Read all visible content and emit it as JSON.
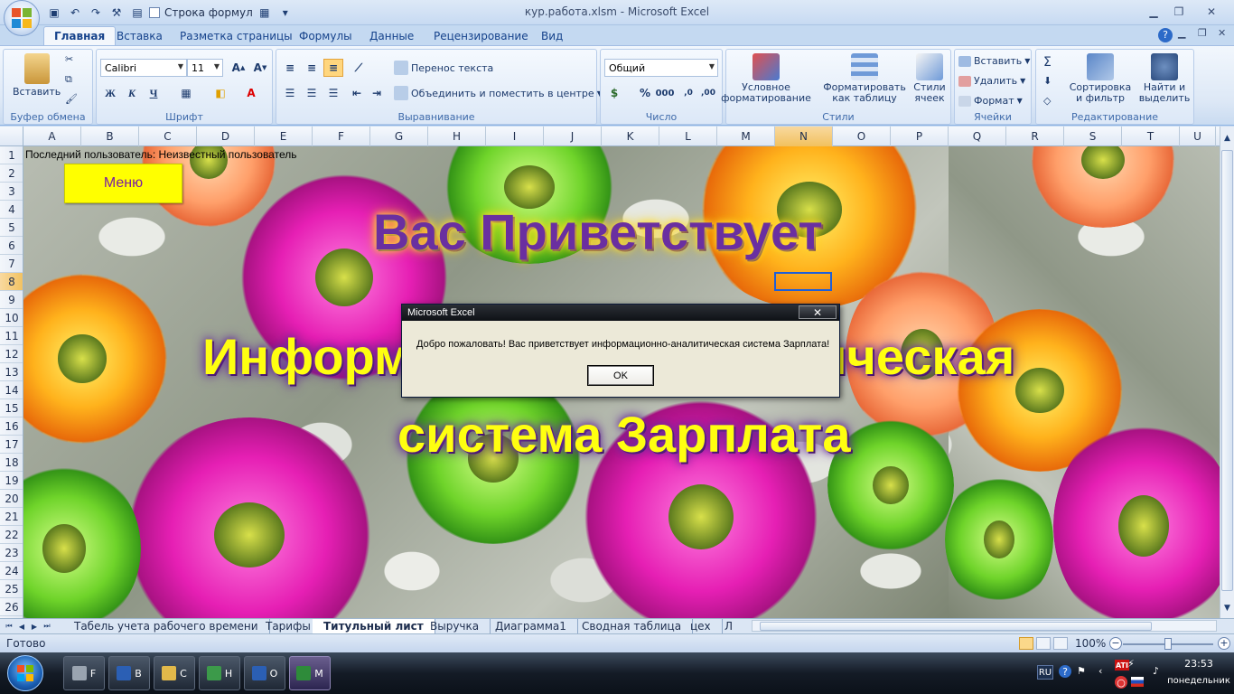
{
  "window": {
    "title": "кур.работа.xlsm - Microsoft Excel",
    "qat_formula_label": "Строка формул"
  },
  "tabs": [
    "Главная",
    "Вставка",
    "Разметка страницы",
    "Формулы",
    "Данные",
    "Рецензирование",
    "Вид"
  ],
  "ribbon": {
    "clipboard": {
      "label": "Буфер обмена",
      "paste": "Вставить"
    },
    "font": {
      "label": "Шрифт",
      "name": "Calibri",
      "size": "11",
      "bold": "Ж",
      "italic": "К",
      "underline": "Ч"
    },
    "alignment": {
      "label": "Выравнивание",
      "wrap": "Перенос текста",
      "merge": "Объединить и поместить в центре"
    },
    "number": {
      "label": "Число",
      "format": "Общий",
      "percent": "%",
      "thousands": "000"
    },
    "styles": {
      "label": "Стили",
      "conditional": "Условное форматирование",
      "as_table": "Форматировать как таблицу",
      "cell_styles": "Стили ячеек"
    },
    "cells": {
      "label": "Ячейки",
      "insert": "Вставить",
      "delete": "Удалить",
      "format": "Формат"
    },
    "editing": {
      "label": "Редактирование",
      "sort": "Сортировка и фильтр",
      "find": "Найти и выделить"
    }
  },
  "columns": [
    "A",
    "B",
    "C",
    "D",
    "E",
    "F",
    "G",
    "H",
    "I",
    "J",
    "K",
    "L",
    "M",
    "N",
    "O",
    "P",
    "Q",
    "R",
    "S",
    "T",
    "U"
  ],
  "selected_column": "N",
  "rows": [
    "1",
    "2",
    "3",
    "4",
    "5",
    "6",
    "7",
    "8",
    "9",
    "10",
    "11",
    "12",
    "13",
    "14",
    "15",
    "16",
    "17",
    "18",
    "19",
    "20",
    "21",
    "22",
    "23",
    "24",
    "25",
    "26"
  ],
  "selected_row": "8",
  "sheet": {
    "last_user": "Последний пользователь: Неизвестный пользователь",
    "menu_button": "Меню",
    "wordart_line1": "Вас Приветствует",
    "wordart_line2": "Информационно-аналитическая",
    "wordart_line3": "система Зарплата"
  },
  "dialog": {
    "title": "Microsoft Excel",
    "message": "Добро пожаловать! Вас приветствует  информационно-аналитическая система Зарплата!",
    "ok": "OK"
  },
  "sheet_tabs": [
    "Табель учета рабочего времени",
    "Тарифы",
    "Титульный лист",
    "Выручка",
    "Диаграмма1",
    "Сводная таблица",
    "цех",
    "Л"
  ],
  "active_sheet": "Титульный лист",
  "status": {
    "ready": "Готово",
    "zoom": "100%"
  },
  "taskbar": {
    "buttons": [
      {
        "letter": "F",
        "icon": "folder-drive-icon"
      },
      {
        "letter": "В",
        "icon": "word-icon"
      },
      {
        "letter": "С",
        "icon": "folder-icon"
      },
      {
        "letter": "Н",
        "icon": "media-icon"
      },
      {
        "letter": "О",
        "icon": "word-icon"
      },
      {
        "letter": "М",
        "icon": "excel-icon"
      }
    ],
    "lang": "RU",
    "time": "23:53",
    "day": "понедельник"
  }
}
